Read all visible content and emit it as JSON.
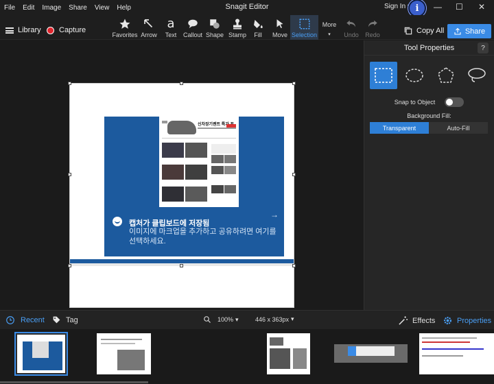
{
  "menu": [
    "File",
    "Edit",
    "Image",
    "Share",
    "View",
    "Help"
  ],
  "app_title": "Snagit Editor",
  "signin": "Sign In",
  "window_controls": {
    "minimize": "—",
    "maximize": "☐",
    "close": "✕"
  },
  "toolbar": {
    "library": "Library",
    "capture": "Capture",
    "tools": [
      {
        "label": "Favorites",
        "icon": "star-icon"
      },
      {
        "label": "Arrow",
        "icon": "arrow-icon"
      },
      {
        "label": "Text",
        "icon": "text-icon"
      },
      {
        "label": "Callout",
        "icon": "callout-icon"
      },
      {
        "label": "Shape",
        "icon": "shape-icon"
      },
      {
        "label": "Stamp",
        "icon": "stamp-icon"
      },
      {
        "label": "Fill",
        "icon": "fill-icon"
      },
      {
        "label": "Move",
        "icon": "move-icon"
      },
      {
        "label": "Selection",
        "icon": "selection-icon",
        "active": true
      }
    ],
    "more": "More",
    "undo": "Undo",
    "redo": "Redo",
    "copy_all": "Copy All",
    "share": "Share"
  },
  "canvas": {
    "notification": {
      "title": "캡처가 클립보드에 저장됨",
      "body": "이미지에 마크업을 추가하고 공유하려면 여기를 선택하세요.",
      "arrow": "→"
    },
    "preview_headline": "신차장기렌트 특가 프"
  },
  "panel": {
    "title": "Tool Properties",
    "help": "?",
    "snap_label": "Snap to Object",
    "bg_fill_label": "Background Fill:",
    "fill_options": [
      "Transparent",
      "Auto-Fill"
    ],
    "fill_selected": "Transparent"
  },
  "bottom": {
    "recent": "Recent",
    "tag": "Tag",
    "zoom": "100%",
    "size": "446 x 363px",
    "effects": "Effects",
    "properties": "Properties"
  },
  "colors": {
    "accent": "#3a8be6",
    "record": "#e0262e",
    "notification": "#1c5a9e"
  }
}
